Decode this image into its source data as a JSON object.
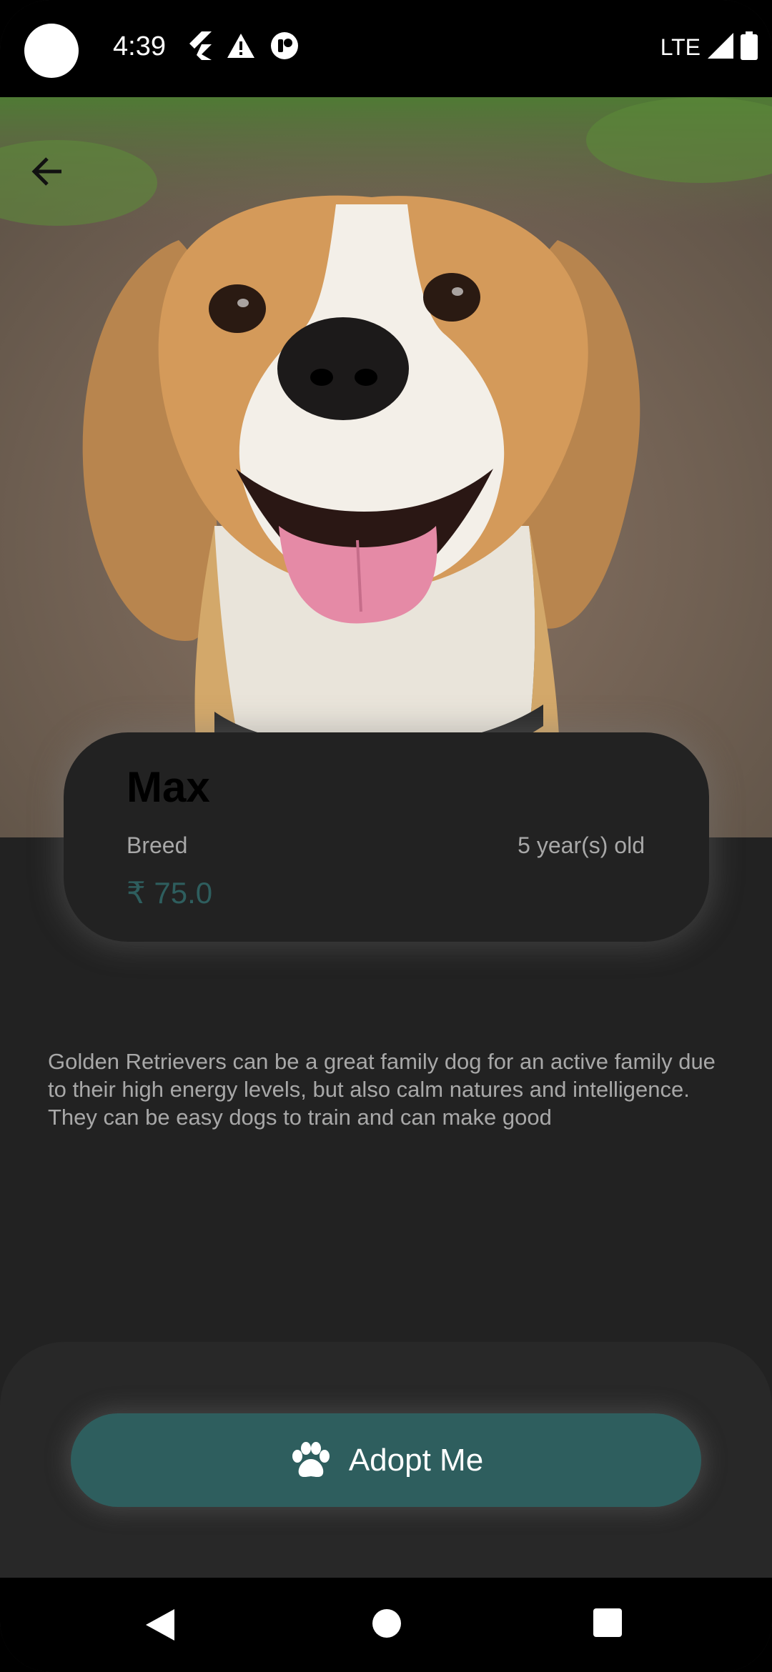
{
  "status_bar": {
    "time": "4:39",
    "network": "LTE",
    "icons": [
      "flutter-icon",
      "warning-icon",
      "notification-app-icon",
      "signal-icon",
      "battery-icon"
    ]
  },
  "hero": {
    "image": "beagle-dog-photo",
    "back_icon": "arrow-left-icon"
  },
  "pet": {
    "name": "Max",
    "breed": "Breed",
    "age": "5 year(s) old",
    "price": "₹ 75.0"
  },
  "description": "Golden Retrievers can be a great family dog for an active family due to their high energy levels, but also calm natures and intelligence. They can be easy dogs to train and can make good",
  "adopt_button": {
    "label": "Adopt Me",
    "icon": "paw-icon"
  },
  "nav_bar": {
    "back": "nav-back-icon",
    "home": "nav-home-icon",
    "recents": "nav-recents-icon"
  },
  "colors": {
    "background": "#222222",
    "accent": "#2e5e5e",
    "text_muted": "#a8a8a8"
  }
}
